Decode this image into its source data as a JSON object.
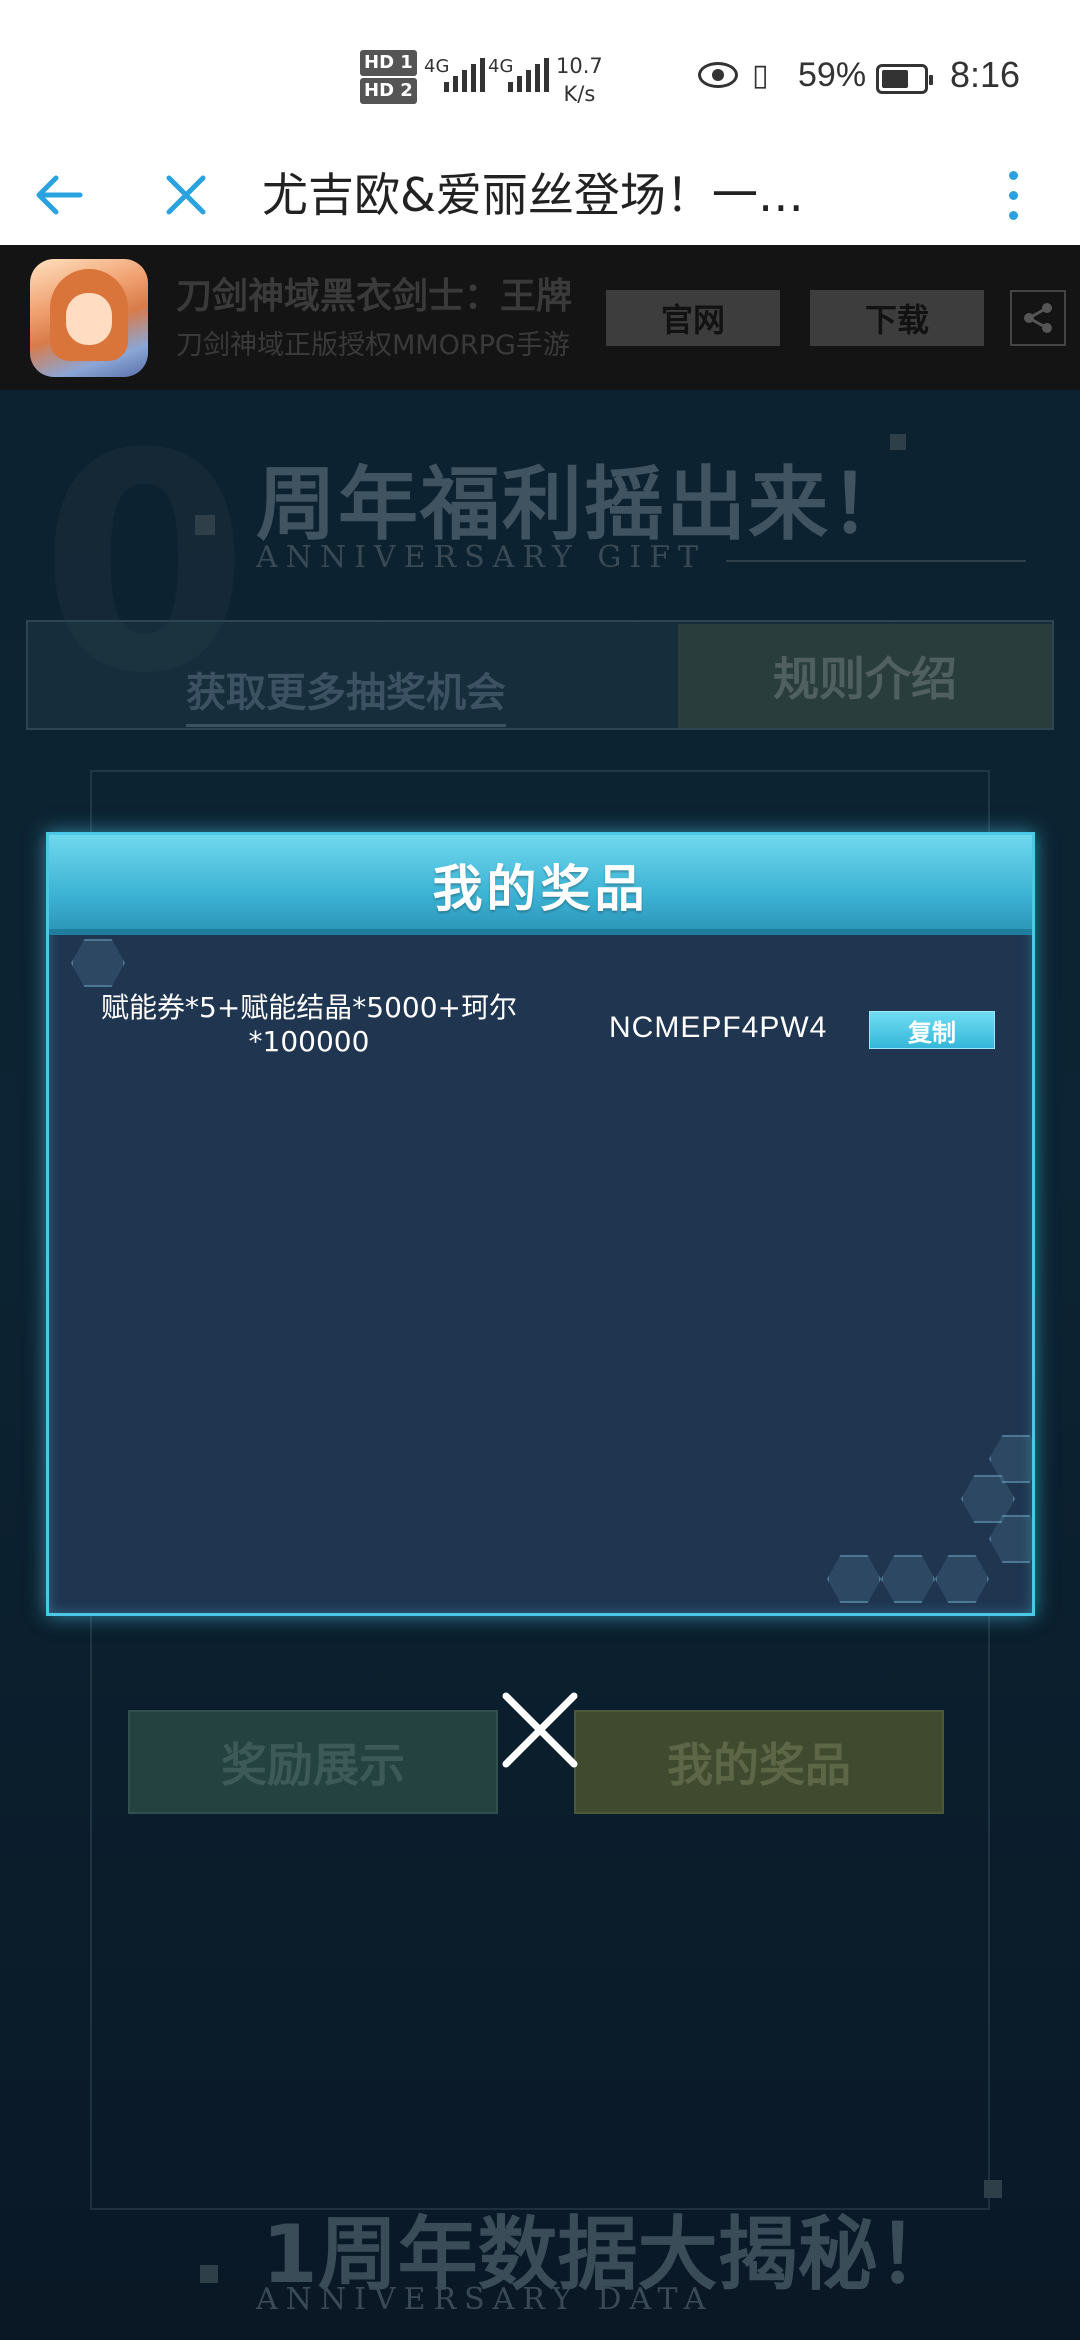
{
  "status_bar": {
    "hd1": "HD 1",
    "hd2": "HD 2",
    "net1": "4G",
    "net2": "4G",
    "speed_value": "10.7",
    "speed_unit": "K/s",
    "battery_percent": "59%",
    "time": "8:16"
  },
  "browser": {
    "title": "尤吉欧&爱丽丝登场！一…",
    "accent": "#2aa2e0"
  },
  "app_banner": {
    "name": "刀剑神域黑衣剑士：王牌",
    "subtitle": "刀剑神域正版授权MMORPG手游",
    "official_site_label": "官网",
    "download_label": "下载"
  },
  "page": {
    "heading": "周年福利摇出来！",
    "heading_en": "ANNIVERSARY GIFT",
    "more_chances_label": "获取更多抽奖机会",
    "rules_label": "规则介绍",
    "reward_display_label": "奖励展示",
    "my_prizes_label": "我的奖品",
    "heading2": "1周年数据大揭秘！",
    "heading2_en": "ANNIVERSARY DATA"
  },
  "modal": {
    "title": "我的奖品",
    "prizes": [
      {
        "name": "赋能券*5+赋能结晶*5000+珂尔*100000",
        "code": "NCMEPF4PW4",
        "copy_label": "复制"
      }
    ],
    "accent": "#4bc8e6"
  }
}
